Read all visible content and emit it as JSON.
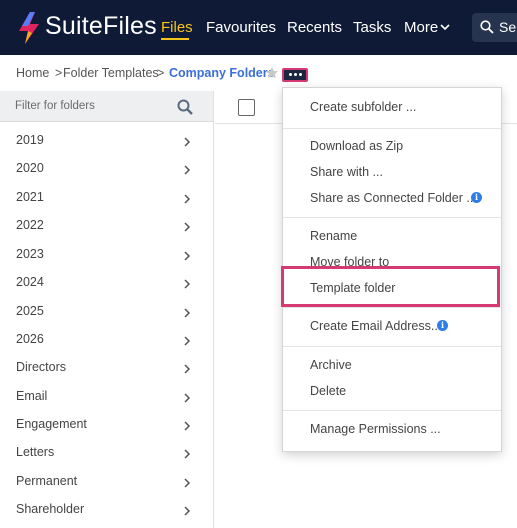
{
  "app": {
    "brand": "SuiteFiles",
    "brand_color": "#0f1b36",
    "accent_color": "#f5c518"
  },
  "nav": {
    "items": [
      {
        "label": "Files",
        "active": true
      },
      {
        "label": "Favourites"
      },
      {
        "label": "Recents"
      },
      {
        "label": "Tasks"
      },
      {
        "label": "More"
      }
    ],
    "search_label": "Se"
  },
  "breadcrumb": {
    "home": "Home",
    "separator": ">",
    "parent": "Folder Templates",
    "current": "Company Folders"
  },
  "sidebar": {
    "filter_placeholder": "Filter for folders",
    "folders": [
      "2019",
      "2020",
      "2021",
      "2022",
      "2023",
      "2024",
      "2025",
      "2026",
      "Directors",
      "Email",
      "Engagement",
      "Letters",
      "Permanent",
      "Shareholder"
    ]
  },
  "menu": {
    "highlight_color": "#d63a74",
    "groups": [
      [
        "Create subfolder ..."
      ],
      [
        "Download as Zip",
        "Share with ...",
        "Share as Connected Folder ..."
      ],
      [
        "Rename",
        "Move folder to",
        "Template folder"
      ],
      [
        "Create Email Address..."
      ],
      [
        "Archive",
        "Delete"
      ],
      [
        "Manage Permissions ..."
      ]
    ],
    "highlighted_item": "Template folder"
  }
}
